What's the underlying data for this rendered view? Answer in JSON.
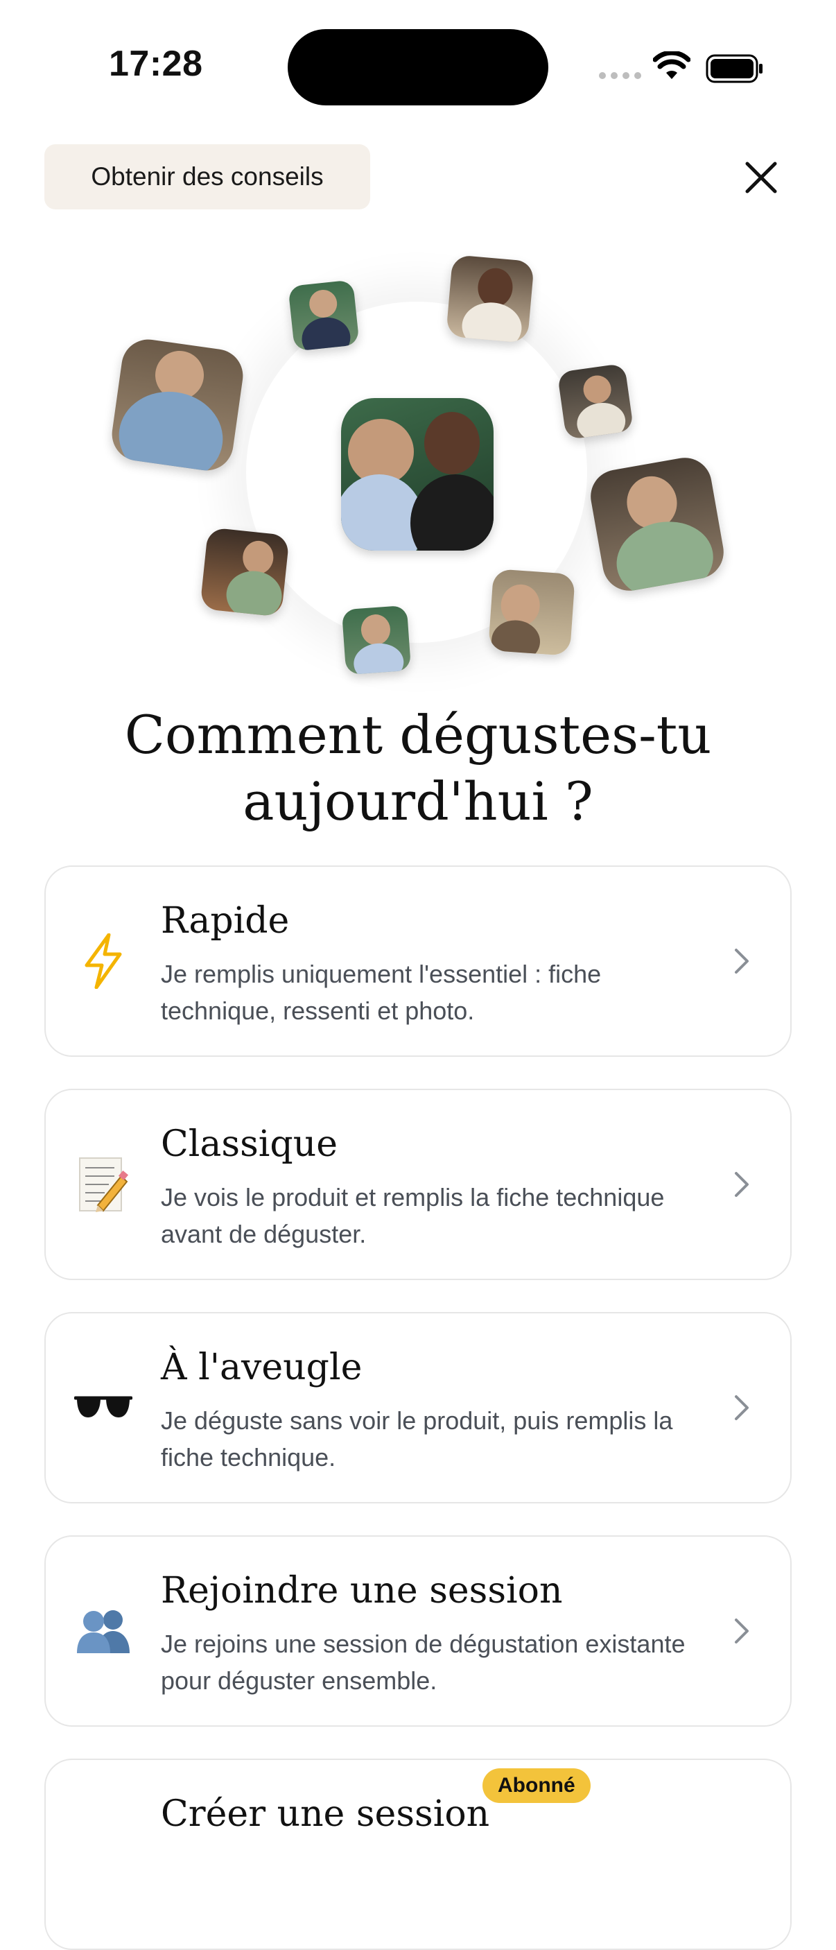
{
  "status_bar": {
    "time": "17:28"
  },
  "header": {
    "tips_label": "Obtenir des conseils",
    "close_icon": "close-icon"
  },
  "hero": {
    "heading_line1": "Comment dégustes-tu",
    "heading_line2": "aujourd'hui ?"
  },
  "options": [
    {
      "icon": "lightning-icon",
      "title": "Rapide",
      "description": "Je remplis uniquement l'essentiel : fiche technique, ressenti et photo."
    },
    {
      "icon": "memo-icon",
      "title": "Classique",
      "description": "Je vois le produit et remplis la fiche technique avant de déguster."
    },
    {
      "icon": "sunglasses-icon",
      "title": "À l'aveugle",
      "description": "Je déguste sans voir le produit, puis remplis la fiche technique."
    },
    {
      "icon": "people-icon",
      "title": "Rejoindre une session",
      "description": "Je rejoins une session de dégustation existante pour déguster ensemble."
    },
    {
      "icon": "create-session-icon",
      "title": "Créer une session",
      "badge": "Abonné",
      "description": ""
    }
  ],
  "colors": {
    "tips_bg": "#f5f0ea",
    "badge_bg": "#f3c33b",
    "card_border": "#e6e6e6",
    "desc_text": "#4a4f57"
  }
}
